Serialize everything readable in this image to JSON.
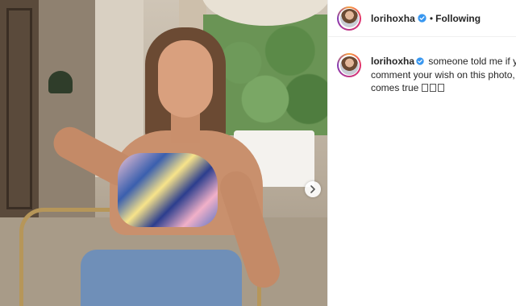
{
  "post": {
    "username": "lorihoxha",
    "follow_separator": "•",
    "follow_status": "Following"
  },
  "caption": {
    "username": "lorihoxha",
    "line1": "someone told me if you",
    "line2": "comment your wish on this photo, it",
    "line3": "comes true",
    "emoji_placeholders": "▯▯▯"
  },
  "icons": {
    "verified": "verified-badge-icon",
    "next": "chevron-right-icon"
  },
  "colors": {
    "verified_blue": "#3897f0",
    "text": "#262626",
    "divider": "#efefef"
  }
}
